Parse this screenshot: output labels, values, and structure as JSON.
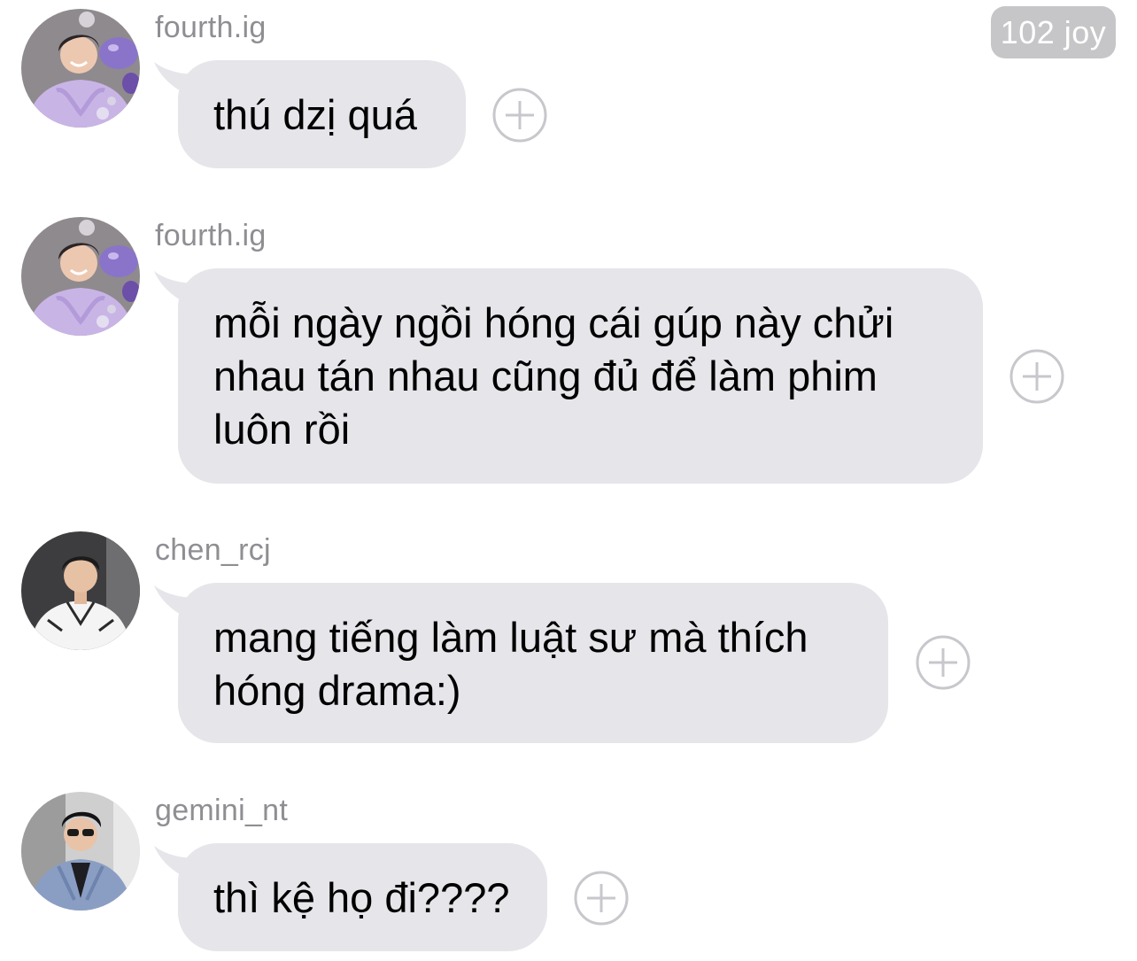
{
  "badge": {
    "text": "102 joy"
  },
  "messages": [
    {
      "username": "fourth.ig",
      "text": "thú dzị quá",
      "avatar_icon": "user-avatar-purple-hoodie-icon"
    },
    {
      "username": "fourth.ig",
      "lines": [
        "mỗi ngày ngồi hóng cái gúp này chửi",
        "nhau tán nhau cũng đủ để làm phim",
        "luôn rồi"
      ],
      "avatar_icon": "user-avatar-purple-hoodie-icon"
    },
    {
      "username": "chen_rcj",
      "lines": [
        "mang tiếng làm luật sư mà thích",
        "hóng drama:)"
      ],
      "avatar_icon": "user-avatar-white-shirt-icon"
    },
    {
      "username": "gemini_nt",
      "text": "thì kệ họ đi????",
      "avatar_icon": "user-avatar-blue-suit-icon"
    }
  ],
  "colors": {
    "bubble": "#e5e5ea",
    "username": "#8e8e93",
    "badge_bg": "#c6c6c8",
    "plus_icon": "#c7c7cc"
  }
}
